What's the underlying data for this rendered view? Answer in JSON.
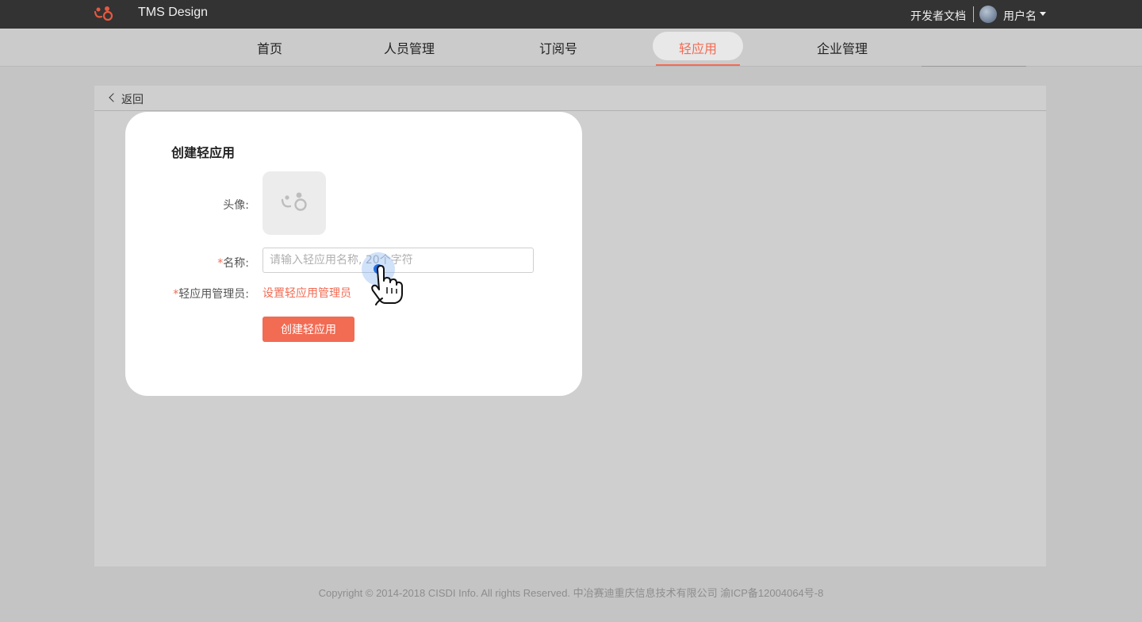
{
  "header": {
    "brand": "TMS Design",
    "dev_docs": "开发者文档",
    "username": "用户名",
    "logo_icon": "tms-logo-icon",
    "avatar_icon": "user-avatar"
  },
  "nav": {
    "items": [
      {
        "label": "首页"
      },
      {
        "label": "人员管理"
      },
      {
        "label": "订阅号"
      },
      {
        "label": "轻应用",
        "active": true
      },
      {
        "label": "企业管理"
      }
    ]
  },
  "page": {
    "back_label": "返回"
  },
  "dialog": {
    "title": "创建轻应用",
    "avatar_label": "头像:",
    "name_label": "名称:",
    "name_placeholder": "请输入轻应用名称, 20个字符",
    "name_value": "",
    "admin_label": "轻应用管理员:",
    "admin_link": "设置轻应用管理员",
    "required_mark": "*",
    "submit_label": "创建轻应用"
  },
  "footer": {
    "copyright": "Copyright © 2014-2018 CISDI Info. All rights Reserved. 中冶赛迪重庆信息技术有限公司 渝ICP备12004064号-8"
  },
  "colors": {
    "accent": "#f26b53",
    "topbar": "#333333",
    "overlay": "#c4c4c4"
  }
}
